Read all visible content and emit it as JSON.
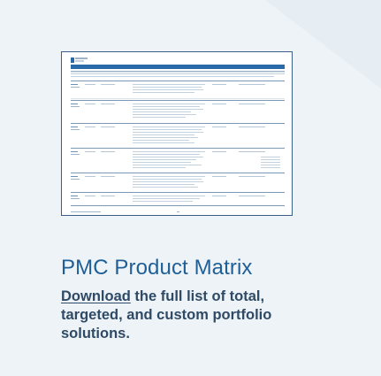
{
  "card": {
    "title": "PMC Product Matrix",
    "download_link": "Download",
    "description_rest": " the full list of total, targeted, and custom portfolio solutions."
  },
  "colors": {
    "background": "#eef3f7",
    "title": "#1f5f96",
    "body_text": "#2f4a66",
    "thumbnail_border": "#3b5f86",
    "thumbnail_header_bar": "#2b6aa8"
  }
}
